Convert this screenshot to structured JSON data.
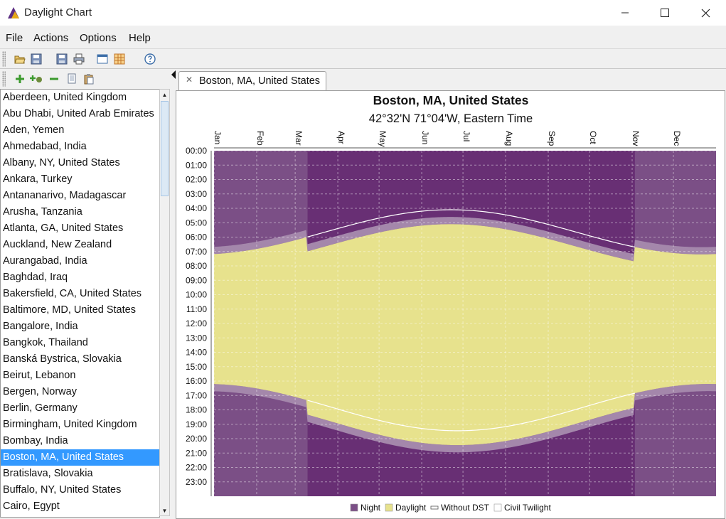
{
  "window": {
    "title": "Daylight Chart"
  },
  "menu": [
    {
      "label": "File"
    },
    {
      "label": "Actions"
    },
    {
      "label": "Options"
    },
    {
      "label": "Help"
    }
  ],
  "tab": {
    "label": "Boston, MA, United States"
  },
  "locations": [
    "Aberdeen, United Kingdom",
    "Abu Dhabi, United Arab Emirates",
    "Aden, Yemen",
    "Ahmedabad, India",
    "Albany, NY, United States",
    "Ankara, Turkey",
    "Antananarivo, Madagascar",
    "Arusha, Tanzania",
    "Atlanta, GA, United States",
    "Auckland, New Zealand",
    "Aurangabad, India",
    "Baghdad, Iraq",
    "Bakersfield, CA, United States",
    "Baltimore, MD, United States",
    "Bangalore, India",
    "Bangkok, Thailand",
    "Banská Bystrica, Slovakia",
    "Beirut, Lebanon",
    "Bergen, Norway",
    "Berlin, Germany",
    "Birmingham, United Kingdom",
    "Bombay, India",
    "Boston, MA, United States",
    "Bratislava, Slovakia",
    "Buffalo, NY, United States",
    "Cairo, Egypt"
  ],
  "selected_location": "Boston, MA, United States",
  "colors": {
    "night": "#7b4f86",
    "night_dst": "#682f74",
    "twilight": "#a487ab",
    "daylight": "#e7e28d",
    "selection": "#3399ff"
  },
  "chart_data": {
    "type": "area",
    "title": "Boston, MA, United States",
    "subtitle": "42°32'N 71°04'W, Eastern Time",
    "months": [
      "Jan",
      "Feb",
      "Mar",
      "Apr",
      "May",
      "Jun",
      "Jul",
      "Aug",
      "Sep",
      "Oct",
      "Nov",
      "Dec"
    ],
    "hours": [
      "00:00",
      "01:00",
      "02:00",
      "03:00",
      "04:00",
      "05:00",
      "06:00",
      "07:00",
      "08:00",
      "09:00",
      "10:00",
      "11:00",
      "12:00",
      "13:00",
      "14:00",
      "15:00",
      "16:00",
      "17:00",
      "18:00",
      "19:00",
      "20:00",
      "21:00",
      "22:00",
      "23:00"
    ],
    "ylim": [
      "00:00",
      "24:00"
    ],
    "grid": true,
    "legend_position": "bottom",
    "legend": [
      "Night",
      "Daylight",
      "Without DST",
      "Civil Twilight"
    ],
    "dst_period": {
      "start_day": 68,
      "end_day": 306
    },
    "sunrise_standard": {
      "min_hours": 4.1,
      "max_hours": 7.2,
      "min_day": 172
    },
    "sunset_standard": {
      "min_hours": 16.2,
      "max_hours": 19.45,
      "max_day": 177
    },
    "civil_twilight_minutes": 30
  }
}
